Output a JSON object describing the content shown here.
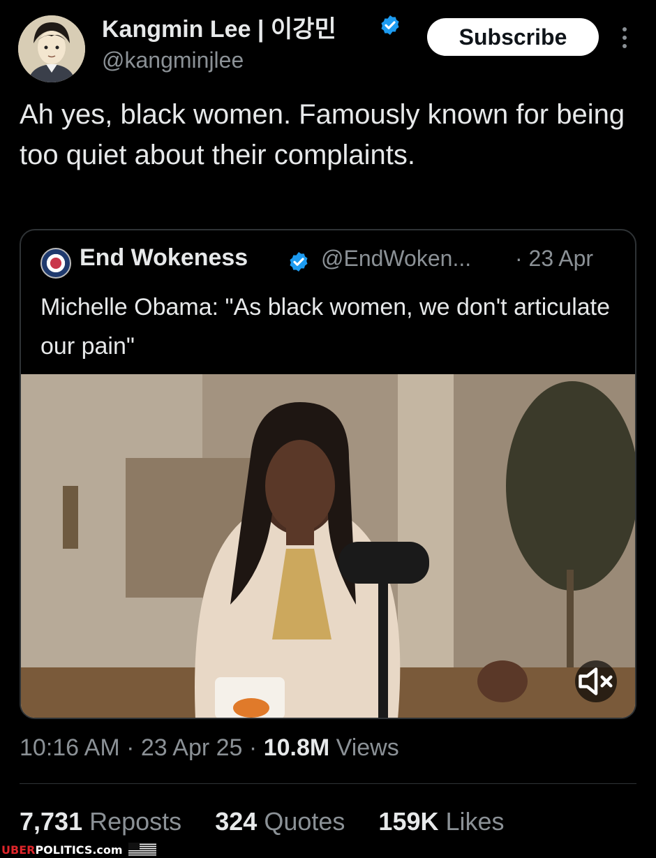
{
  "author": {
    "display_name": "Kangmin Lee | 이강민",
    "handle": "@kangminjlee",
    "avatar_icon": "user-avatar-icon"
  },
  "actions": {
    "subscribe_label": "Subscribe",
    "more_icon": "more-vertical-icon"
  },
  "tweet": {
    "text": "Ah yes, black women. Famously known for being too quiet about their complaints."
  },
  "quote": {
    "display_name": "End Wokeness",
    "handle": "@EndWoken...",
    "date": "· 23 Apr",
    "text": "Michelle Obama: \"As black women, we don't articulate our pain\"",
    "mute_icon": "volume-muted-icon"
  },
  "meta": {
    "time": "10:16 AM",
    "date": "23 Apr 25",
    "views_count": "10.8M",
    "views_label": "Views",
    "separator": "·"
  },
  "stats": {
    "reposts_count": "7,731",
    "reposts_label": "Reposts",
    "quotes_count": "324",
    "quotes_label": "Quotes",
    "likes_count": "159K",
    "likes_label": "Likes"
  },
  "watermark": {
    "part1": "UBER",
    "part2": "POLITICS.com"
  },
  "colors": {
    "background": "#000000",
    "primary_text": "#e7e9ea",
    "secondary_text": "#8b9196",
    "verified_blue": "#1d9bf0",
    "watermark_red": "#e0262b"
  }
}
